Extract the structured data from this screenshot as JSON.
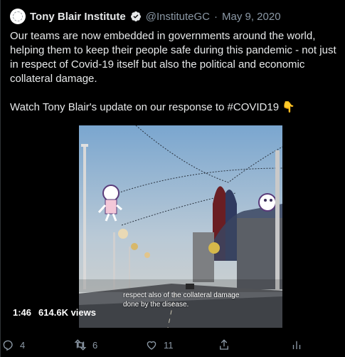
{
  "tweet": {
    "author_name": "Tony Blair Institute",
    "handle": "@InstituteGC",
    "separator": "·",
    "date": "May 9, 2020",
    "paragraph1": "Our teams are now embedded in governments around the world, helping them to keep their people safe during this pandemic - not just in respect of Covid-19 itself but also the political and economic collateral damage.",
    "paragraph2": "Watch Tony Blair's update on our response to #COVID19 👇",
    "avatar_icon": "institute-logo-icon",
    "verified_icon": "verified-badge-icon"
  },
  "video": {
    "caption": "respect also of the collateral damage done by the disease.",
    "duration": "1:46",
    "views": "614.6K views"
  },
  "actions": {
    "reply_count": "4",
    "retweet_count": "6",
    "like_count": "11"
  },
  "colors": {
    "background": "#000000",
    "text_primary": "#e7e9ea",
    "text_secondary": "#8b98a5",
    "verified_blue": "#1d9bf0"
  }
}
